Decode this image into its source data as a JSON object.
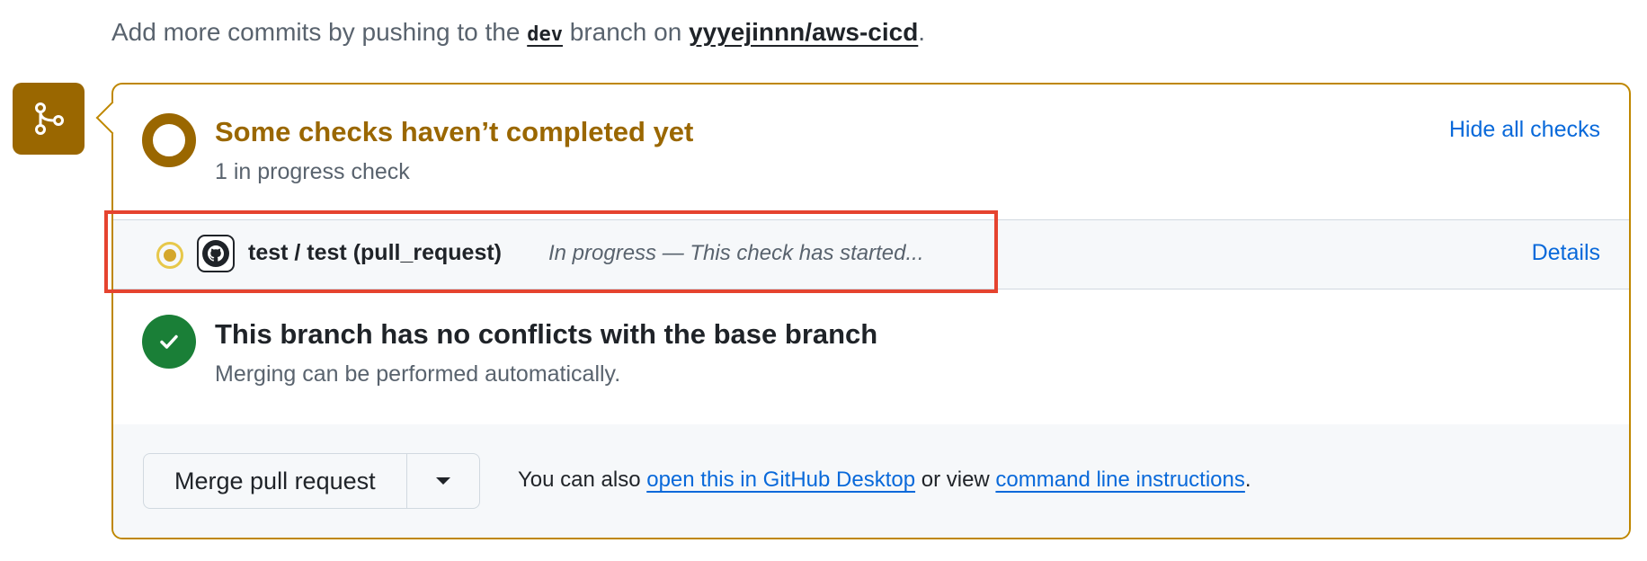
{
  "top_note": {
    "prefix": "Add more commits by pushing to the ",
    "branch": "dev",
    "middle": " branch on ",
    "repo": "yyyejinnn/aws-cicd",
    "suffix": "."
  },
  "status": {
    "title": "Some checks haven’t completed yet",
    "subtitle": "1 in progress check",
    "hide_label": "Hide all checks"
  },
  "check": {
    "name": "test / test (pull_request)",
    "description": "In progress — This check has started...",
    "details_label": "Details"
  },
  "conflicts": {
    "title": "This branch has no conflicts with the base branch",
    "subtitle": "Merging can be performed automatically."
  },
  "actions": {
    "merge_label": "Merge pull request",
    "also_prefix": "You can also ",
    "desktop_link": "open this in GitHub Desktop",
    "also_middle": " or view ",
    "cli_link": "command line instructions",
    "also_suffix": "."
  },
  "colors": {
    "pending": "#9a6700",
    "success": "#1a7f37",
    "link": "#0969da",
    "highlight": "#e5432f"
  },
  "icons": {
    "merge_badge": "git-merge-icon",
    "pending": "pending-ring-icon",
    "progress": "in-progress-dot-icon",
    "avatar": "github-mark-icon",
    "success": "check-icon",
    "caret": "triangle-down-icon"
  }
}
